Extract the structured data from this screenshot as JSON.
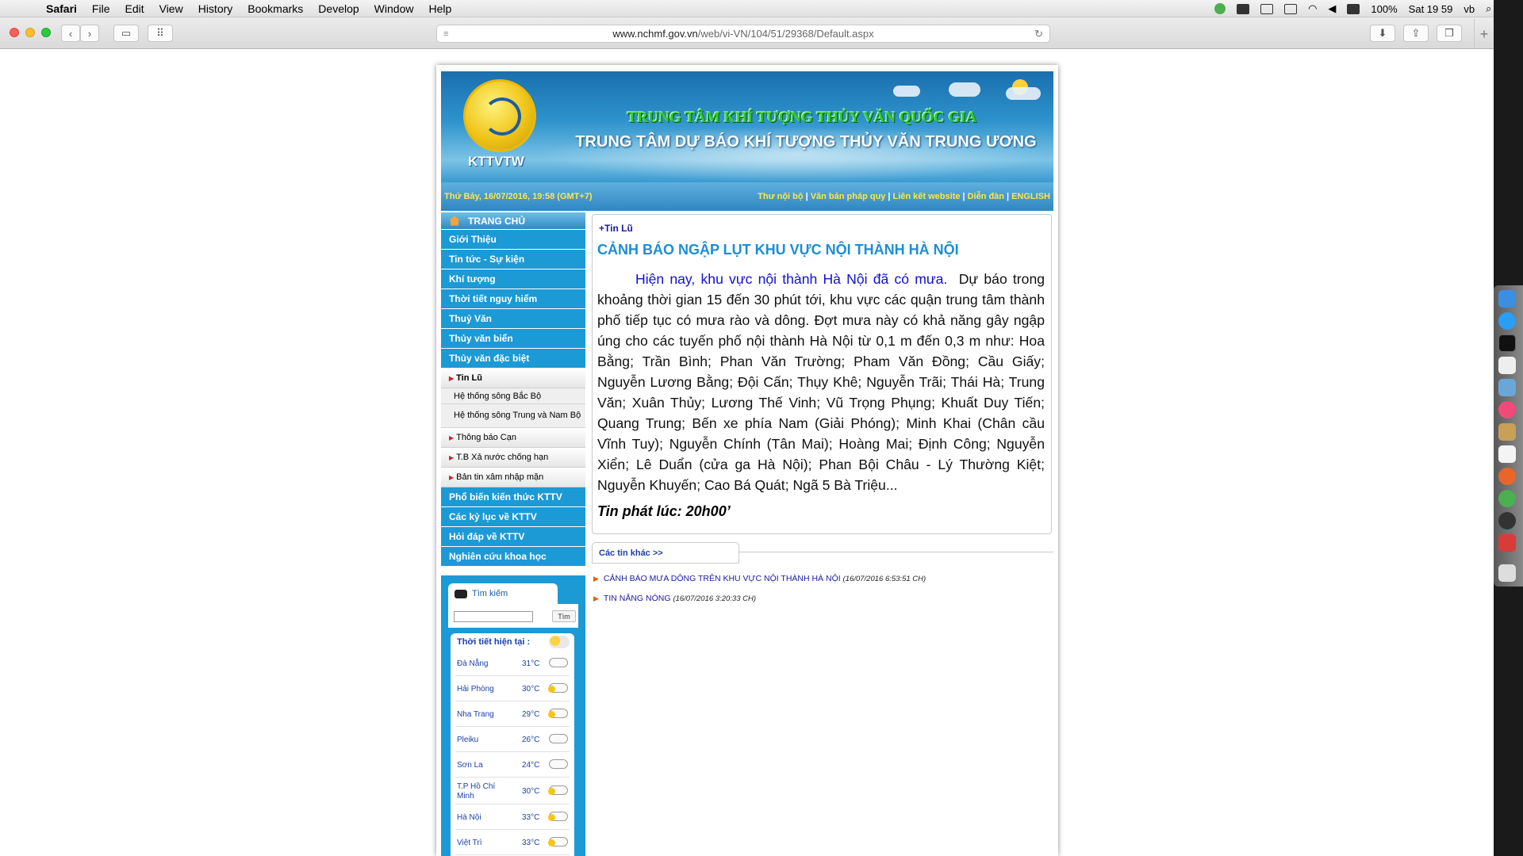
{
  "menubar": {
    "app": "Safari",
    "items": [
      "File",
      "Edit",
      "View",
      "History",
      "Bookmarks",
      "Develop",
      "Window",
      "Help"
    ],
    "battery": "100%",
    "clock": "Sat 19 59",
    "user": "vb"
  },
  "browser": {
    "url_host": "www.nchmf.gov.vn",
    "url_path": "/web/vi-VN/104/51/29368/Default.aspx"
  },
  "header": {
    "logo_text": "KTTVTW",
    "title_org": "TRUNG TÂM KHÍ TƯỢNG THỦY VĂN QUỐC GIA",
    "title_center": "TRUNG TÂM DỰ BÁO KHÍ TƯỢNG THỦY VĂN TRUNG ƯƠNG",
    "date": "Thứ Bảy, 16/07/2016, 19:58 (GMT+7)",
    "links": [
      "Thư nội bộ",
      "Văn bản pháp quy",
      "Liên kết website",
      "Diễn đàn",
      "ENGLISH"
    ]
  },
  "sidebar": {
    "home": "TRANG CHỦ",
    "items_top": [
      "Giới Thiệu",
      "Tin tức - Sự kiện",
      "Khí tượng",
      "Thời tiết nguy hiểm",
      "Thuỷ Văn",
      "Thủy văn biển",
      "Thủy văn đặc biệt"
    ],
    "sub_active": "Tin Lũ",
    "sub2": [
      "Hệ thống sông Bắc Bộ",
      "Hệ thống sông Trung và Nam Bộ"
    ],
    "sub_more": [
      "Thông báo Cạn",
      "T.B Xả nước chống hạn",
      "Bản tin xâm nhập mặn"
    ],
    "items_bottom": [
      "Phổ biến kiến thức KTTV",
      "Các kỷ lục về KTTV",
      "Hỏi đáp về KTTV",
      "Nghiên cứu khoa học"
    ]
  },
  "search": {
    "label": "Tìm kiếm",
    "button": "Tìm",
    "value": ""
  },
  "weather": {
    "title": "Thời tiết hiện tại :",
    "rows": [
      {
        "city": "Đà Nẵng",
        "temp": "31°C",
        "icon": "cloud-icon"
      },
      {
        "city": "Hải Phòng",
        "temp": "30°C",
        "icon": "partly-cloudy-icon"
      },
      {
        "city": "Nha Trang",
        "temp": "29°C",
        "icon": "partly-cloudy-icon"
      },
      {
        "city": "Pleiku",
        "temp": "26°C",
        "icon": "cloud-icon"
      },
      {
        "city": "Sơn La",
        "temp": "24°C",
        "icon": "cloud-icon"
      },
      {
        "city": "T.P Hồ Chí Minh",
        "temp": "30°C",
        "icon": "partly-cloudy-icon"
      },
      {
        "city": "Hà Nội",
        "temp": "33°C",
        "icon": "partly-cloudy-icon"
      },
      {
        "city": "Việt Trì",
        "temp": "33°C",
        "icon": "partly-cloudy-icon"
      }
    ]
  },
  "article": {
    "tag": "+Tin Lũ",
    "headline": "CẢNH BÁO NGẬP LỤT KHU VỰC NỘI THÀNH HÀ NỘI",
    "lead": "Hiện nay, khu vực nội thành Hà Nội đã có mưa.",
    "body": "Dự báo trong khoảng thời gian 15 đến 30 phút tới, khu vực các quận trung tâm thành phố tiếp tục có mưa rào và dông. Đợt mưa này có khả năng gây ngập úng cho các tuyến phố nội thành Hà Nội từ 0,1 m đến 0,3 m như: Hoa Bằng; Trần Bình; Phan Văn Trường; Pham Văn Đồng; Cầu Giấy; Nguyễn Lương Bằng; Đội Cấn; Thụy Khê; Nguyễn Trãi; Thái Hà; Trung Văn; Xuân Thủy; Lương Thế Vinh; Vũ Trọng Phụng; Khuất Duy Tiến; Quang Trung; Bến xe phía Nam (Giải Phóng); Minh Khai (Chân cầu Vĩnh Tuy); Nguyễn Chính (Tân Mai); Hoàng Mai; Định Công; Nguyễn Xiển; Lê Duẩn (cửa ga Hà Nội); Phan Bội Châu - Lý Thường Kiệt; Nguyễn Khuyến; Cao Bá Quát; Ngã 5 Bà Triệu...",
    "issued": "Tin phát lúc: 20h00’"
  },
  "others": {
    "label": "Các tin khác >>",
    "items": [
      {
        "title": "CẢNH BÁO MƯA DÔNG TRÊN KHU VỰC NỘI THÀNH HÀ NỘI",
        "time": "(16/07/2016 6:53:51 CH)"
      },
      {
        "title": "TIN NẮNG NÓNG",
        "time": "(16/07/2016 3:20:33 CH)"
      }
    ]
  }
}
